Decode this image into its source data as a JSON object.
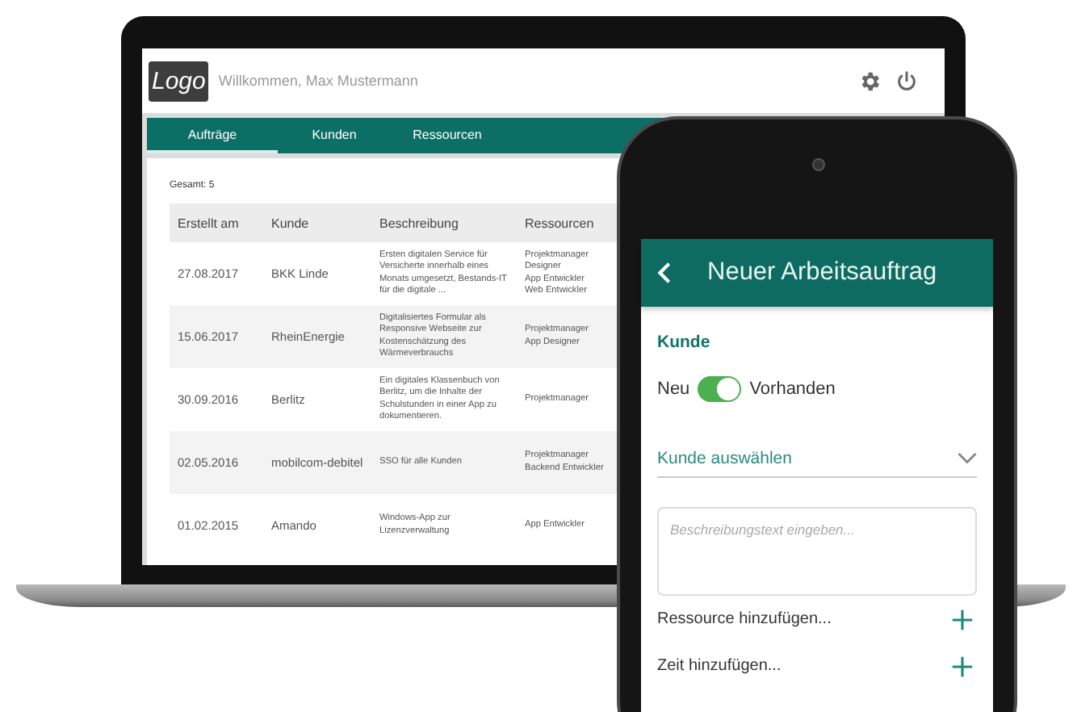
{
  "laptop": {
    "header": {
      "logo": "Logo",
      "welcome": "Willkommen, Max Mustermann"
    },
    "tabs": [
      {
        "label": "Aufträge",
        "selected": true
      },
      {
        "label": "Kunden",
        "selected": false
      },
      {
        "label": "Ressourcen",
        "selected": false
      }
    ],
    "total": "Gesamt: 5",
    "table": {
      "columns": [
        "Erstellt am",
        "Kunde",
        "Beschreibung",
        "Ressourcen"
      ],
      "rows": [
        {
          "created": "27.08.2017",
          "customer": "BKK Linde",
          "description": "Ersten digitalen Service für Versicherte innerhalb eines Monats umgesetzt, Bestands-IT für die digitale ...",
          "resources": [
            "Projektmanager",
            "Designer",
            "App Entwickler",
            "Web Entwickler"
          ]
        },
        {
          "created": "15.06.2017",
          "customer": "RheinEnergie",
          "description": "Digitalisiertes Formular als Responsive Webseite zur Kostenschätzung des Wärmeverbrauchs",
          "resources": [
            "Projektmanager",
            "App Designer"
          ]
        },
        {
          "created": "30.09.2016",
          "customer": "Berlitz",
          "description": "Ein digitales Klassenbuch von Berlitz, um die Inhalte der Schulstunden in einer App zu dokumentieren.",
          "resources": [
            "Projektmanager"
          ]
        },
        {
          "created": "02.05.2016",
          "customer": "mobilcom-debitel",
          "description": "SSO für alle Kunden",
          "resources": [
            "Projektmanager",
            "Backend Entwickler"
          ]
        },
        {
          "created": "01.02.2015",
          "customer": "Amando",
          "description": "Windows-App zur Lizenzverwaltung",
          "resources": [
            "App Entwickler"
          ]
        }
      ]
    }
  },
  "phone": {
    "title": "Neuer Arbeitsauftrag",
    "section_label": "Kunde",
    "toggle": {
      "off_label": "Neu",
      "on_label": "Vorhanden",
      "on": true
    },
    "customer_select": {
      "label": "Kunde auswählen"
    },
    "description_field": {
      "placeholder": "Beschreibungstext eingeben..."
    },
    "actions": [
      {
        "label": "Ressource hinzufügen..."
      },
      {
        "label": "Zeit hinzufügen..."
      }
    ]
  }
}
